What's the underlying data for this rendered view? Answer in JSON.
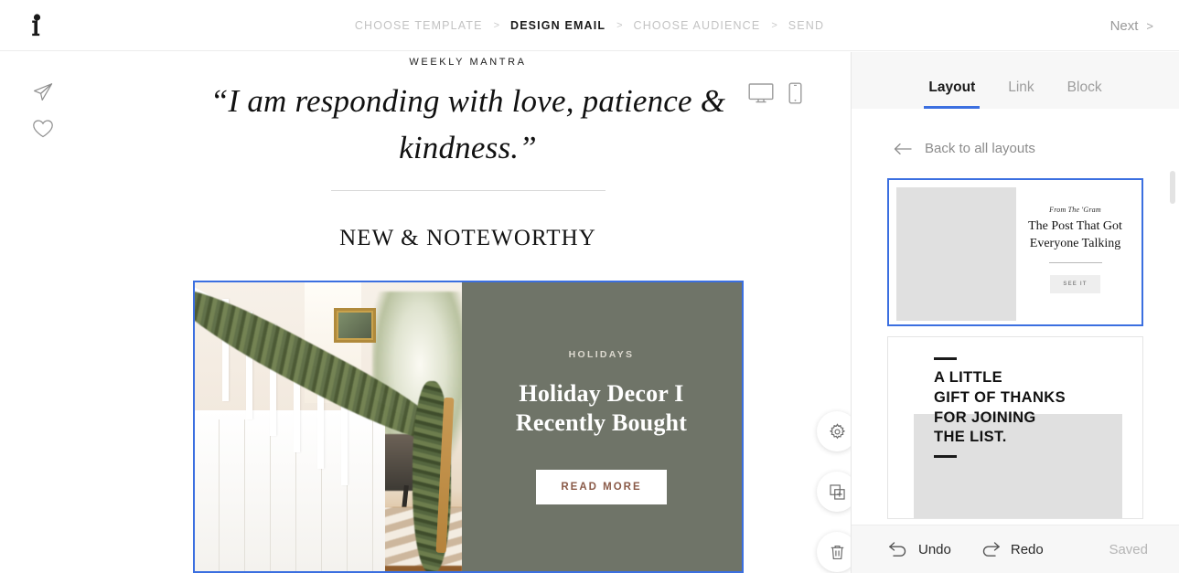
{
  "header": {
    "logo_icon": "brand-logo-icon",
    "breadcrumb": [
      {
        "label": "CHOOSE TEMPLATE",
        "active": false
      },
      {
        "label": "DESIGN EMAIL",
        "active": true
      },
      {
        "label": "CHOOSE AUDIENCE",
        "active": false
      },
      {
        "label": "SEND",
        "active": false
      }
    ],
    "separator": ">",
    "next_label": "Next",
    "next_chevron": ">"
  },
  "left_rail": {
    "items": [
      {
        "name": "send-icon",
        "label": "Send"
      },
      {
        "name": "heart-icon",
        "label": "Favorite"
      }
    ]
  },
  "device_toggle": {
    "desktop_icon": "desktop-icon",
    "mobile_icon": "mobile-icon",
    "selected": "desktop"
  },
  "email": {
    "mantra_label": "WEEKLY MANTRA",
    "mantra_quote": "“I am responding with love, patience & kindness.”",
    "section_title": "NEW & NOTEWORTHY",
    "block": {
      "category": "HOLIDAYS",
      "heading": "Holiday Decor I Recently Bought",
      "button_label": "READ MORE",
      "background_color": "#6f7468",
      "button_text_color": "#8a5a48",
      "selection_color": "#3b6fe0",
      "image_alt": "staircase-with-greenery-garland"
    },
    "block_toolbar": [
      {
        "name": "settings-gear-icon",
        "label": "Settings"
      },
      {
        "name": "duplicate-block-icon",
        "label": "Duplicate"
      },
      {
        "name": "delete-trash-icon",
        "label": "Delete"
      }
    ]
  },
  "right_panel": {
    "tabs": [
      {
        "label": "Layout",
        "active": true
      },
      {
        "label": "Link",
        "active": false
      },
      {
        "label": "Block",
        "active": false
      }
    ],
    "active_tab_color": "#3b6fe0",
    "back_link": "Back to all layouts",
    "back_arrow": "←",
    "layouts": [
      {
        "selected": true,
        "eyebrow": "From The 'Gram",
        "heading": "The Post That Got Everyone Talking",
        "button_label": "SEE IT"
      },
      {
        "selected": false,
        "heading_lines": [
          "A LITTLE",
          "GIFT OF THANKS",
          "FOR JOINING",
          "THE LIST."
        ]
      }
    ],
    "footer": {
      "undo_label": "Undo",
      "redo_label": "Redo",
      "undo_icon": "undo-arrow-icon",
      "redo_icon": "redo-arrow-icon",
      "status_label": "Saved"
    }
  }
}
